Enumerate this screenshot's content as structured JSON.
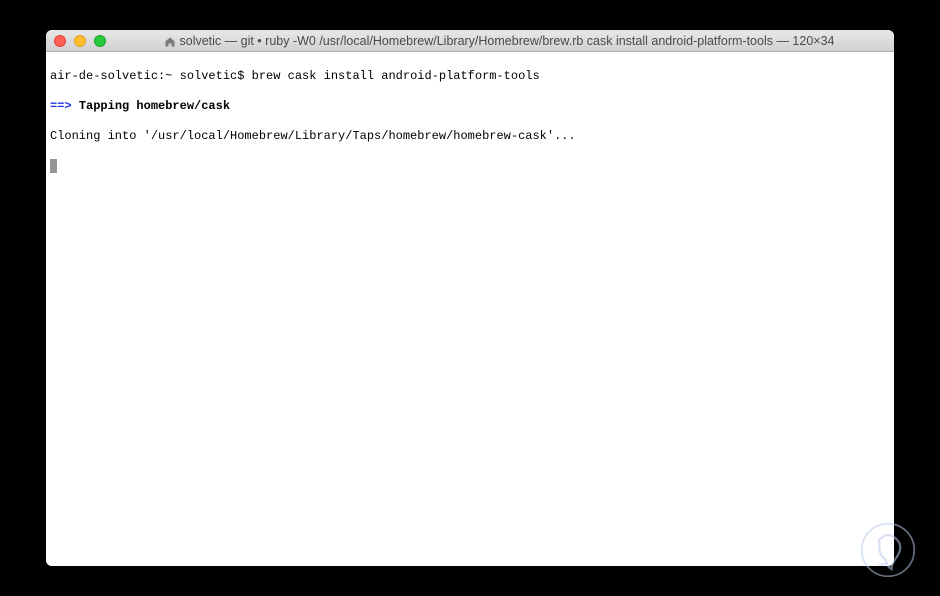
{
  "window": {
    "title": "solvetic — git • ruby -W0 /usr/local/Homebrew/Library/Homebrew/brew.rb cask install android-platform-tools — 120×34"
  },
  "terminal": {
    "prompt_host": "air-de-solvetic:",
    "prompt_path": "~",
    "prompt_user": "solvetic$",
    "command": "brew cask install android-platform-tools",
    "arrow": "==>",
    "status_bold": "Tapping homebrew/cask",
    "line3": "Cloning into '/usr/local/Homebrew/Library/Taps/homebrew/homebrew-cask'..."
  }
}
